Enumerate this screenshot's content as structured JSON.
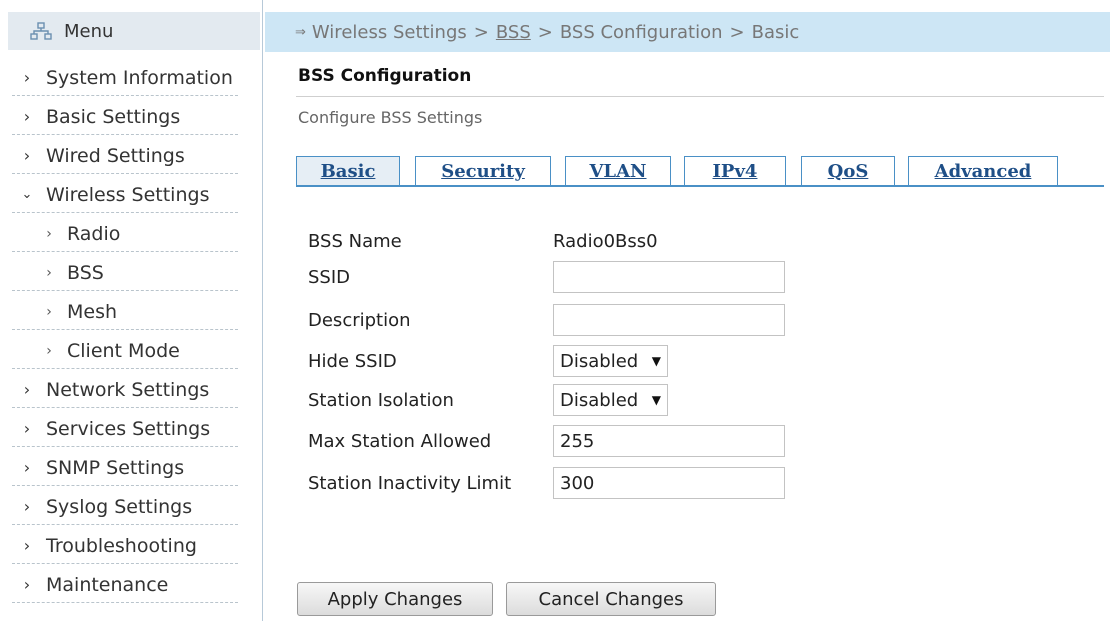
{
  "sidebar": {
    "header": "Menu",
    "items": [
      {
        "label": "System Information",
        "icon": "chevron-right-icon",
        "sub": false
      },
      {
        "label": "Basic Settings",
        "icon": "chevron-right-icon",
        "sub": false
      },
      {
        "label": "Wired Settings",
        "icon": "chevron-right-icon",
        "sub": false
      },
      {
        "label": "Wireless Settings",
        "icon": "chevron-down-icon",
        "sub": false
      },
      {
        "label": "Radio",
        "icon": "chevron-right-icon",
        "sub": true
      },
      {
        "label": "BSS",
        "icon": "chevron-right-icon",
        "sub": true
      },
      {
        "label": "Mesh",
        "icon": "chevron-right-icon",
        "sub": true
      },
      {
        "label": "Client Mode",
        "icon": "chevron-right-icon",
        "sub": true
      },
      {
        "label": "Network Settings",
        "icon": "chevron-right-icon",
        "sub": false
      },
      {
        "label": "Services Settings",
        "icon": "chevron-right-icon",
        "sub": false
      },
      {
        "label": "SNMP Settings",
        "icon": "chevron-right-icon",
        "sub": false
      },
      {
        "label": "Syslog Settings",
        "icon": "chevron-right-icon",
        "sub": false
      },
      {
        "label": "Troubleshooting",
        "icon": "chevron-right-icon",
        "sub": false
      },
      {
        "label": "Maintenance",
        "icon": "chevron-right-icon",
        "sub": false
      }
    ]
  },
  "breadcrumb": {
    "items": [
      "Wireless Settings",
      "BSS",
      "BSS Configuration",
      "Basic"
    ],
    "separator": ">"
  },
  "page": {
    "title": "BSS Configuration",
    "subtitle": "Configure BSS Settings"
  },
  "tabs": [
    "Basic",
    "Security",
    "VLAN",
    "IPv4",
    "QoS",
    "Advanced"
  ],
  "form": {
    "bss_name_label": "BSS Name",
    "bss_name_value": "Radio0Bss0",
    "ssid_label": "SSID",
    "ssid_value": "",
    "description_label": "Description",
    "description_value": "",
    "hide_ssid_label": "Hide SSID",
    "hide_ssid_value": "Disabled",
    "station_isolation_label": "Station Isolation",
    "station_isolation_value": "Disabled",
    "max_station_label": "Max Station Allowed",
    "max_station_value": "255",
    "inactivity_label": "Station Inactivity Limit",
    "inactivity_value": "300"
  },
  "buttons": {
    "apply": "Apply Changes",
    "cancel": "Cancel Changes"
  },
  "colors": {
    "breadcrumb_bg": "#cde6f5",
    "menu_header_bg": "#e3eaf0",
    "tab_border": "#4a90c6",
    "tab_text": "#1f4f87"
  }
}
